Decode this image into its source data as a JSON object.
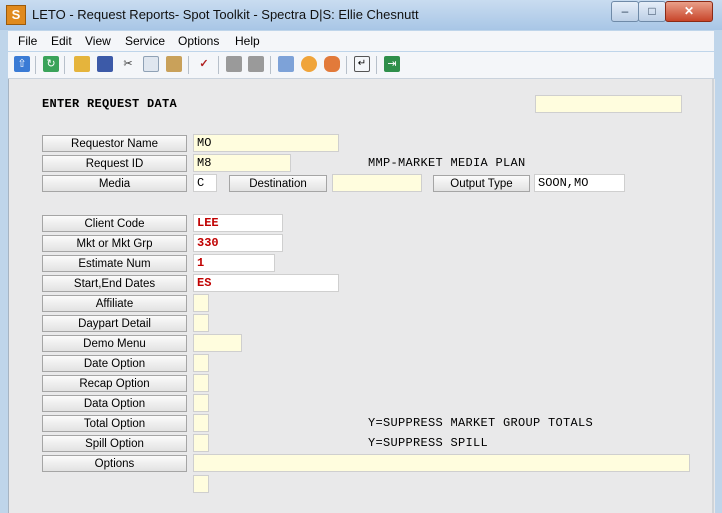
{
  "window": {
    "title": "LETO - Request Reports- Spot Toolkit - Spectra D|S: Ellie Chesnutt"
  },
  "window_controls": {
    "minimize": "–",
    "maximize": "□",
    "close": "✕"
  },
  "menu": [
    "File",
    "Edit",
    "View",
    "Service",
    "Options",
    "Help"
  ],
  "toolbar_icons": [
    "upload-icon",
    "refresh-icon",
    "open-folder-icon",
    "save-icon",
    "cut-icon",
    "copy-icon",
    "paste-icon",
    "spellcheck-icon",
    "disabled-icon",
    "disabled-icon",
    "window-copy-icon",
    "clock-icon",
    "users-icon",
    "print-preview-icon",
    "exit-icon"
  ],
  "form": {
    "heading": "ENTER REQUEST DATA",
    "top_right_field": "",
    "requestor_name": {
      "label": "Requestor Name",
      "value": "MO"
    },
    "request_id": {
      "label": "Request ID",
      "value": "M8"
    },
    "request_description": "MMP-MARKET MEDIA PLAN",
    "media": {
      "label": "Media",
      "value": "C"
    },
    "destination": {
      "label": "Destination",
      "value": ""
    },
    "output_type": {
      "label": "Output Type",
      "value": "SOON,MO"
    },
    "client_code": {
      "label": "Client Code",
      "value": "LEE"
    },
    "mkt_grp": {
      "label": "Mkt or Mkt Grp",
      "value": "330"
    },
    "estimate_num": {
      "label": "Estimate Num",
      "value": "1"
    },
    "start_end_dates": {
      "label": "Start,End Dates",
      "value": "ES"
    },
    "affiliate": {
      "label": "Affiliate",
      "value": ""
    },
    "daypart_detail": {
      "label": "Daypart Detail",
      "value": ""
    },
    "demo_menu": {
      "label": "Demo Menu",
      "value": ""
    },
    "date_option": {
      "label": "Date Option",
      "value": ""
    },
    "recap_option": {
      "label": "Recap Option",
      "value": ""
    },
    "data_option": {
      "label": "Data Option",
      "value": ""
    },
    "total_option": {
      "label": "Total Option",
      "value": "",
      "hint": "Y=SUPPRESS MARKET GROUP TOTALS"
    },
    "spill_option": {
      "label": "Spill Option",
      "value": "",
      "hint": "Y=SUPPRESS SPILL"
    },
    "options": {
      "label": "Options",
      "value": ""
    },
    "extra_field": ""
  },
  "colors": {
    "field_bg": "#fffdde",
    "required_value": "#c00000",
    "client_bg": "#e9e9ea",
    "frame": "#bfd5ea"
  }
}
